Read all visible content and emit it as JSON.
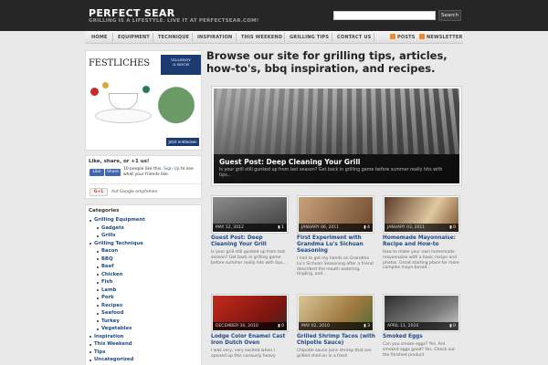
{
  "site": {
    "title": "PERFECT SEAR",
    "tagline": "GRILLING IS A LIFESTYLE. LIVE IT AT PERFECTSEAR.COM!",
    "search_placeholder": "",
    "search_button": "Search"
  },
  "nav": {
    "items": [
      "HOME",
      "EQUIPMENT",
      "TECHNIQUE",
      "INSPIRATION",
      "THIS WEEKEND",
      "GRILLING TIPS",
      "CONTACT US"
    ],
    "posts": "POSTS",
    "newsletter": "NEWSLETTER",
    "rss_icon": "rss-icon",
    "rss_color": "#f08a24"
  },
  "ad": {
    "title": "FESTLICHES",
    "brand_line1": "VILLEROY",
    "brand_line2": "& BOCH",
    "cta": "Jetzt entdecken"
  },
  "share": {
    "title": "Like, share, or +1 us!",
    "like": "Like",
    "share": "Share",
    "count_text": "10 people like this.",
    "signup": "Sign Up",
    "signup_rest": "to see what your friends like.",
    "gplus": "G+1",
    "gplus_text": "Auf Google empfehlen"
  },
  "categories": {
    "title": "Categories",
    "items": [
      {
        "label": "Grilling Equipment",
        "level": 0
      },
      {
        "label": "Gadgets",
        "level": 1
      },
      {
        "label": "Grills",
        "level": 1
      },
      {
        "label": "Grilling Technique",
        "level": 0
      },
      {
        "label": "Bacon",
        "level": 1
      },
      {
        "label": "BBQ",
        "level": 1
      },
      {
        "label": "Beef",
        "level": 1
      },
      {
        "label": "Chicken",
        "level": 1
      },
      {
        "label": "Fish",
        "level": 1
      },
      {
        "label": "Lamb",
        "level": 1
      },
      {
        "label": "Pork",
        "level": 1
      },
      {
        "label": "Recipes",
        "level": 1
      },
      {
        "label": "Seafood",
        "level": 1
      },
      {
        "label": "Turkey",
        "level": 1
      },
      {
        "label": "Vegetables",
        "level": 1
      },
      {
        "label": "Inspiration",
        "level": 0
      },
      {
        "label": "This Weekend",
        "level": 0
      },
      {
        "label": "Tips",
        "level": 0
      },
      {
        "label": "Uncategorized",
        "level": 0
      }
    ]
  },
  "main": {
    "headline": "Browse our site for grilling tips, articles, how-to's, bbq inspiration, and recipes.",
    "featured": {
      "title": "Guest Post: Deep Cleaning Your Grill",
      "excerpt": "Is your grill still gunked up from last season? Get back in grilling game before summer really hits with tips..."
    },
    "posts": [
      {
        "date": "MAY 12, 2012",
        "comments": "1",
        "title": "Guest Post: Deep Cleaning Your Grill",
        "excerpt": "Is your grill still gunked up from last season? Get back in grilling game before summer really hits with tips..."
      },
      {
        "date": "JANUARY 06, 2011",
        "comments": "4",
        "title": "First Experiment with Grandma Lu's Sichuan Seasoning",
        "excerpt": "I had to get my hands on Grandma Lu's Sichuan Seasoning after a friend described the mouth watering, tingling, and..."
      },
      {
        "date": "JANUARY 03, 2011",
        "comments": "0",
        "title": "Homemade Mayonnaise: Recipe and How-to",
        "excerpt": "How to make your own homemade mayonnaise with a basic recipe and photos. Great starting place for more complex mayo-based..."
      },
      {
        "date": "DECEMBER 30, 2010",
        "comments": "0",
        "title": "Lodge Color Enamel Cast Iron Dutch Oven",
        "excerpt": "I was very, very excited when I opened up this curiously heavy"
      },
      {
        "date": "MAY 02, 2010",
        "comments": "3",
        "title": "Grilled Shrimp Tacos (with Chipotle Sauce)",
        "excerpt": "Chipotle sauce joins shrimp that are grilled shell on in a fresh"
      },
      {
        "date": "APRIL 11, 2010",
        "comments": "0",
        "title": "Smoked Eggs",
        "excerpt": "Can you smoke eggs? Yes. Are smoked eggs good? Yes. Check out the finished product"
      }
    ]
  }
}
